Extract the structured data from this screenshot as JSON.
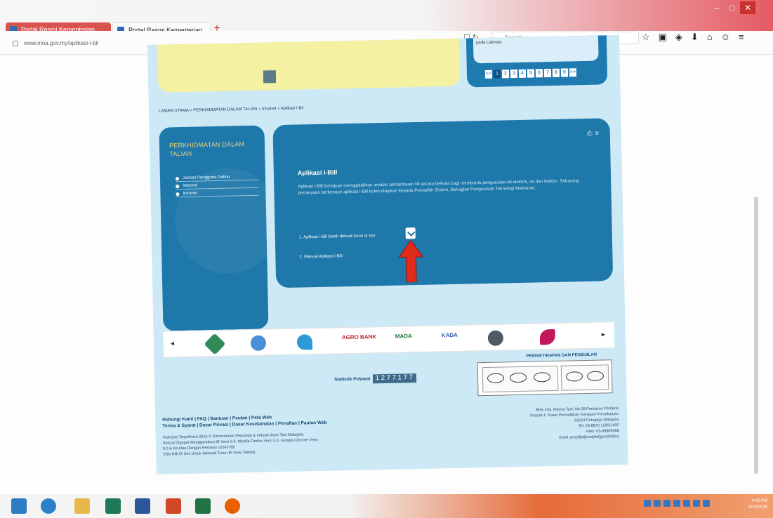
{
  "browser": {
    "tabs": [
      {
        "label": "Portal Rasmi Kementerian ..."
      },
      {
        "label": "Portal Rasmi Kementerian ..."
      }
    ],
    "url": "www.moa.gov.my/aplikasi-i-bil",
    "search_placeholder": "Search"
  },
  "page": {
    "announcement_text": "pada Lainnya",
    "pagination": [
      "<<",
      "1",
      "2",
      "3",
      "4",
      "5",
      "6",
      "7",
      "8",
      "9",
      ">>"
    ],
    "breadcrumb": "LAMAN UTAMA » PERKHIDMATAN DALAM TALIAN » Intranet » Aplikasi i-Bil",
    "sidebar": {
      "title": "PERKHIDMATAN DALAM TALIAN",
      "items": [
        {
          "label": "Jumlah Pengguna Online"
        },
        {
          "label": "Internet"
        },
        {
          "label": "Intranet"
        }
      ]
    },
    "content": {
      "title": "Aplikasi i-Bill",
      "body": "Aplikasi i-Bill bertujuan menggalakkan amalan pemantauan bil secara berkala bagi membantu pengurusan bil elektrik, air dan telefon. Sebarang pertanyaan berkenaan aplikasi i-Bill boleh diajukan kepada Pentadbir Sistem, Bahagian Pengurusan Teknologi Maklumat.",
      "step1": "1. Aplikasi i-Bill boleh dimuat turun di sini",
      "step2": "2. Manual Aplikasi i-Bill"
    },
    "partners": [
      "AGRO BANK",
      "MADA",
      "KADA"
    ],
    "certifications_label": "PENGIKTIRAFAN DAN PENSIJILAN",
    "visitors_label": "Statistik Pelawat",
    "visitor_count": "1277177",
    "footer_links": [
      "Hubungi Kami | FAQ | Bantuan | Peutan | Peta Web",
      "Terma & Syarat | Dasar Privasi | Dasar Keselamatan | Penafian | Pautan Web"
    ],
    "footer_note": [
      "Hakcipta Terpelihara 2016 © Kementerian Pertanian & Industri Asas Tani Malaysia.",
      "Sesuai Dipapar Menggunakan IE Versi 9.0, Mozilla Firefox Versi 3.0, Google Chrome Versi",
      "8.0 & Ke Atas Dengan Resolusi 1024x768",
      "(Sila Klik Di Sini Untuk Memuat Turun IE Versi Terkini)"
    ],
    "footer_address": [
      "Blok 4G1 Wisma Tani, No.28 Persiaran Perdana",
      "Presint 4, Pusat Pentadbiran Kerajaan Persekutuan",
      "62624 Putrajaya Malaysia",
      "Tel: 03-8870 1200/1400",
      "Faks: 03-88885588",
      "Emel: projaf[at]moa[dot]gov[dot]my"
    ]
  },
  "taskbar": {
    "clock_time": "4:43 PM",
    "clock_date": "8/29/2016"
  },
  "colors": {
    "page_bg": "#cde9f6",
    "panel_blue": "#1e78aa",
    "banner_yellow": "#f5f1a3",
    "accent_red": "#d9534f"
  }
}
